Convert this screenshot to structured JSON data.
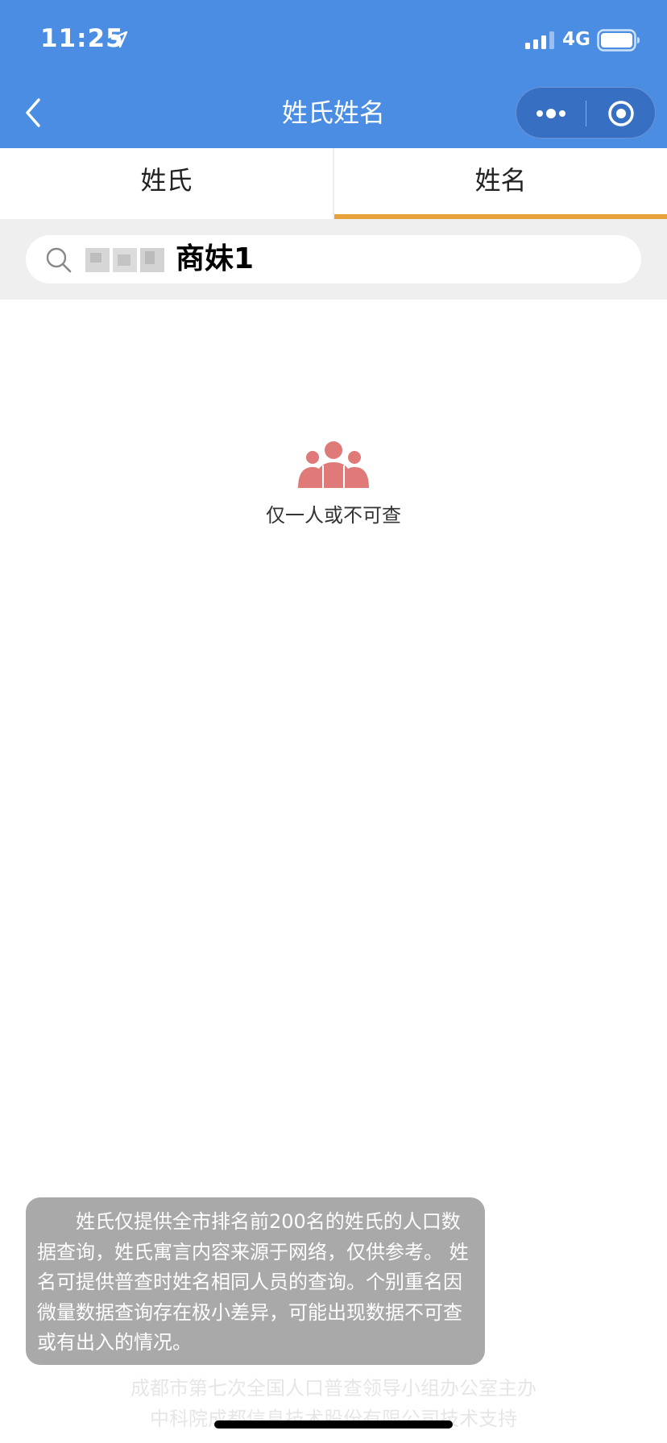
{
  "status_bar": {
    "time": "11:25",
    "network": "4G"
  },
  "nav": {
    "title": "姓氏姓名",
    "back_icon": "chevron-left-icon",
    "more_icon": "more-dots-icon",
    "close_icon": "target-close-icon"
  },
  "tabs": [
    {
      "label": "姓氏",
      "active": false
    },
    {
      "label": "姓名",
      "active": true
    }
  ],
  "search": {
    "value": "商妹1",
    "icon": "search-icon"
  },
  "empty_state": {
    "icon": "people-group-icon",
    "message": "仅一人或不可查"
  },
  "notice": {
    "text": "姓氏仅提供全市排名前200名的姓氏的人口数据查询，姓氏寓言内容来源于网络，仅供参考。 姓名可提供普查时姓名相同人员的查询。个别重名因微量数据查询存在极小差异，可能出现数据不可查或有出入的情况。"
  },
  "credits": {
    "line1": "成都市第七次全国人口普查领导小组办公室主办",
    "line2": "中科院成都信息技术股份有限公司技术支持"
  },
  "colors": {
    "header": "#4a8de3",
    "tab_underline": "#e8a23c",
    "empty_icon": "#e07a78",
    "notice_bg": "#a9a9a9"
  }
}
